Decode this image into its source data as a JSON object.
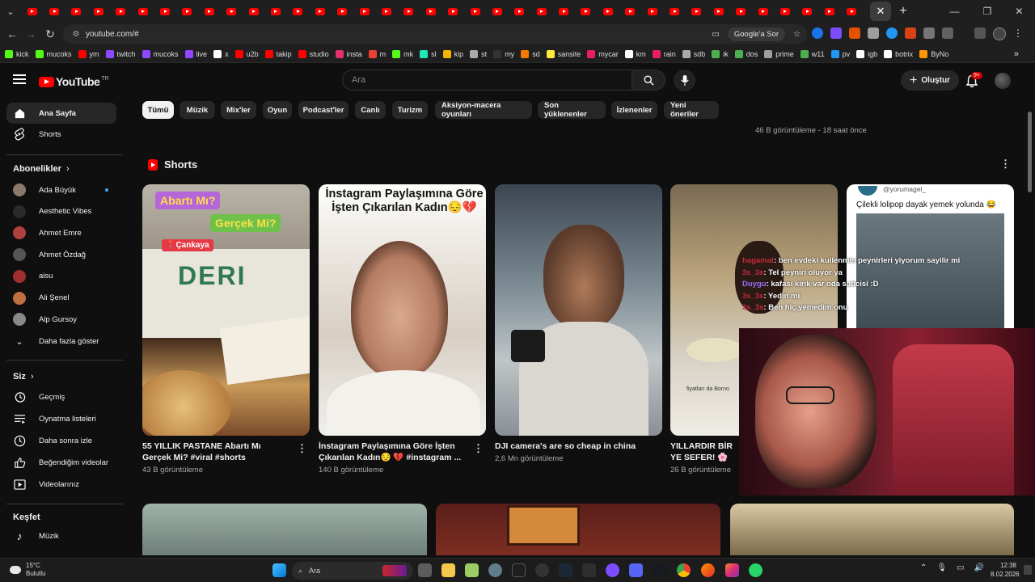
{
  "browser": {
    "url": "youtube.com/#",
    "google_sor": "Google'a Sor",
    "bookmarks": [
      {
        "label": "kick",
        "color": "#53fc18"
      },
      {
        "label": "mucoks",
        "color": "#53fc18"
      },
      {
        "label": "ym",
        "color": "#ff0000"
      },
      {
        "label": "twitch",
        "color": "#9146ff"
      },
      {
        "label": "mucoks",
        "color": "#9146ff"
      },
      {
        "label": "live",
        "color": "#9146ff"
      },
      {
        "label": "x",
        "color": "#ffffff"
      },
      {
        "label": "u2b",
        "color": "#ff0000"
      },
      {
        "label": "takip",
        "color": "#ff0000"
      },
      {
        "label": "studio",
        "color": "#ff0000"
      },
      {
        "label": "insta",
        "color": "#e1306c"
      },
      {
        "label": "m",
        "color": "#ea4335"
      },
      {
        "label": "mk",
        "color": "#53fc18"
      },
      {
        "label": "sl",
        "color": "#1de9b6"
      },
      {
        "label": "kip",
        "color": "#f4b400"
      },
      {
        "label": "st",
        "color": "#aaaaaa"
      },
      {
        "label": "my",
        "color": "#333333"
      },
      {
        "label": "sd",
        "color": "#f57c00"
      },
      {
        "label": "sansite",
        "color": "#ffeb3b"
      },
      {
        "label": "mycar",
        "color": "#e91e63"
      },
      {
        "label": "km",
        "color": "#ffffff"
      },
      {
        "label": "rain",
        "color": "#e91e63"
      },
      {
        "label": "sdb",
        "color": "#aaaaaa"
      },
      {
        "label": "ik",
        "color": "#4caf50"
      },
      {
        "label": "dos",
        "color": "#4caf50"
      },
      {
        "label": "prime",
        "color": "#9e9e9e"
      },
      {
        "label": "w11",
        "color": "#4caf50"
      },
      {
        "label": "pv",
        "color": "#2196f3"
      },
      {
        "label": "igb",
        "color": "#ffffff"
      },
      {
        "label": "botrix",
        "color": "#ffffff"
      },
      {
        "label": "ByNo",
        "color": "#ff9800"
      }
    ]
  },
  "header": {
    "logo": "YouTube",
    "logo_suffix": "TR",
    "search_placeholder": "Ara",
    "create_label": "Oluştur",
    "notif_badge": "9+"
  },
  "sidebar": {
    "main": [
      {
        "label": "Ana Sayfa"
      },
      {
        "label": "Shorts"
      }
    ],
    "subs_title": "Abonelikler",
    "subs": [
      {
        "label": "Ada Büyük",
        "color": "#8a7a6a"
      },
      {
        "label": "Aesthetic Vibes",
        "color": "#2a2a2a"
      },
      {
        "label": "Ahmet Emre",
        "color": "#b04040"
      },
      {
        "label": "Ahmet Özdağ",
        "color": "#555555"
      },
      {
        "label": "aisu",
        "color": "#a03030"
      },
      {
        "label": "Ali Şenel",
        "color": "#c07040"
      },
      {
        "label": "Alp Gursoy",
        "color": "#888888"
      }
    ],
    "more": "Daha fazla göster",
    "you_title": "Siz",
    "you": [
      {
        "label": "Geçmiş"
      },
      {
        "label": "Oynatma listeleri"
      },
      {
        "label": "Daha sonra izle"
      },
      {
        "label": "Beğendiğim videolar"
      },
      {
        "label": "Videolarınız"
      }
    ],
    "explore_title": "Keşfet",
    "explore": [
      {
        "label": "Müzik"
      }
    ]
  },
  "chips": [
    "Tümü",
    "Müzik",
    "Mix'ler",
    "Oyun",
    "Podcast'ler",
    "Canlı",
    "Turizm",
    "Aksiyon-macera oyunları",
    "Son yüklenenler",
    "İzlenenler",
    "Yeni öneriler"
  ],
  "top_meta": "46 B görüntüleme - 18 saat önce",
  "shorts": {
    "title": "Shorts",
    "items": [
      {
        "title": "55 YILLIK PASTANE Abartı Mı Gerçek Mi? #viral #shorts",
        "views": "43 B görüntüleme",
        "overlay1": "Abartı Mı?",
        "overlay2": "Gerçek Mi?",
        "overlay3": "Çankaya",
        "sign": "DERI"
      },
      {
        "title": "İnstagram Paylaşımına Göre İşten Çıkarılan Kadın😔 💔 #instagram ...",
        "views": "140 B görüntüleme",
        "overlay1": "İnstagram Paylaşımına Göre",
        "overlay2": "İşten Çıkarılan Kadın😔💔"
      },
      {
        "title": "DJI camera's are so cheap in china",
        "views": "2,6 Mn görüntüleme"
      },
      {
        "title": "YILLARDIR BİR YE SEFER! 🌸",
        "views": "26 B görüntüleme",
        "overlay1": "fiyatları da Borno"
      },
      {
        "title": "",
        "views": "",
        "overlay1": "@yorumagel_",
        "overlay2": "Çilekli lolipop dayak yemek yolunda 😂"
      }
    ]
  },
  "chat": [
    {
      "user": "hagamat",
      "msg": ": ben evdeki kullenmis peynirleri yiyorum sayilir mi"
    },
    {
      "user": "3s_3s",
      "msg": ": Tel peyniri oluyor ya"
    },
    {
      "user": "Duygu",
      "msg": ": kafası kirik var oda saticisi :D"
    },
    {
      "user": "3s_3s",
      "msg": ": Yedin mi"
    },
    {
      "user": "3s_3s",
      "msg": ": Ben hiç yemedim onu"
    }
  ],
  "taskbar": {
    "temp": "15°C",
    "weather": "Bulutlu",
    "search": "Ara",
    "time": "12:38",
    "date": "8.02.2026"
  }
}
